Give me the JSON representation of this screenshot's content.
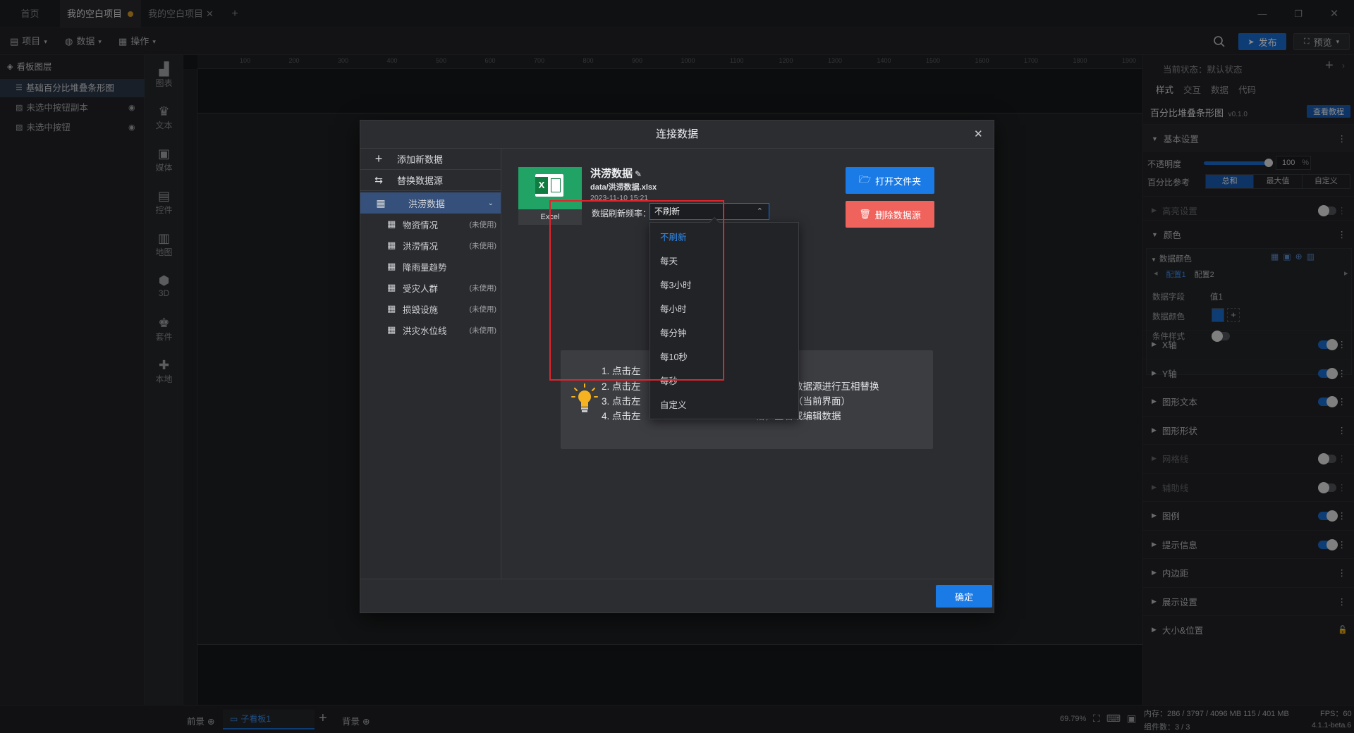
{
  "tabs": [
    {
      "label": "首页"
    },
    {
      "label": "我的空白项目"
    },
    {
      "label": "我的空白项目"
    }
  ],
  "toolbar": {
    "project": "项目",
    "data": "数据",
    "operate": "操作",
    "publish": "发布",
    "preview": "预览"
  },
  "layers": {
    "title": "看板图层",
    "items": [
      {
        "label": "基础百分比堆叠条形图"
      },
      {
        "label": "未选中按钮副本"
      },
      {
        "label": "未选中按钮"
      }
    ]
  },
  "rail": [
    {
      "label": "图表",
      "icon": "chart-icon"
    },
    {
      "label": "文本",
      "icon": "text-icon"
    },
    {
      "label": "媒体",
      "icon": "media-icon"
    },
    {
      "label": "控件",
      "icon": "control-icon"
    },
    {
      "label": "地图",
      "icon": "map-icon"
    },
    {
      "label": "3D",
      "icon": "cube-icon"
    },
    {
      "label": "套件",
      "icon": "kit-icon"
    },
    {
      "label": "本地",
      "icon": "puzzle-icon"
    }
  ],
  "ruler": {
    "ticks": [
      "100",
      "200",
      "300",
      "400",
      "500",
      "600",
      "700",
      "800",
      "900",
      "1000",
      "1100",
      "1200",
      "1300",
      "1400",
      "1500",
      "1600",
      "1700",
      "1800",
      "1900"
    ]
  },
  "props": {
    "state_label": "当前状态：",
    "state_value": "默认状态",
    "tabs": [
      "样式",
      "交互",
      "数据",
      "代码"
    ],
    "component_name": "百分比堆叠条形图",
    "version": "v0.1.0",
    "tutorial_btn": "查看教程",
    "basic_settings": "基本设置",
    "opacity_label": "不透明度",
    "opacity_value": "100",
    "opacity_unit": "%",
    "percent_ref_label": "百分比参考",
    "percent_ref_options": [
      "总和",
      "最大值",
      "自定义"
    ],
    "highlight": "高亮设置",
    "color": "颜色",
    "data_color": "数据颜色",
    "config_tabs": [
      "配置1",
      "配置2"
    ],
    "data_field_label": "数据字段",
    "data_field_value": "值1",
    "data_color_label": "数据颜色",
    "condition_style_label": "条件样式",
    "sections": [
      {
        "label": "X轴",
        "toggle": "on",
        "dim": false
      },
      {
        "label": "Y轴",
        "toggle": "on",
        "dim": false
      },
      {
        "label": "图形文本",
        "toggle": "on",
        "dim": false
      },
      {
        "label": "图形形状",
        "toggle": "none",
        "dim": false
      },
      {
        "label": "网格线",
        "toggle": "off",
        "dim": true
      },
      {
        "label": "辅助线",
        "toggle": "off",
        "dim": true
      },
      {
        "label": "图例",
        "toggle": "on",
        "dim": false
      },
      {
        "label": "提示信息",
        "toggle": "on",
        "dim": false
      },
      {
        "label": "内边距",
        "toggle": "none",
        "dim": false
      },
      {
        "label": "展示设置",
        "toggle": "none",
        "dim": false
      },
      {
        "label": "大小&位置",
        "toggle": "none",
        "dim": false
      }
    ]
  },
  "status": {
    "front": "前景",
    "board": "子看板1",
    "background": "背景",
    "zoom": "69.79%",
    "memory": "内存：286 / 3797 / 4096 MB  115 / 401 MB",
    "fps": "FPS：60",
    "components": "组件数：3 / 3",
    "version": "4.1.1-beta.6"
  },
  "dialog": {
    "title": "连接数据",
    "add_new": "添加新数据",
    "replace": "替换数据源",
    "current_source": "洪涝数据",
    "sheets": [
      {
        "name": "物资情况",
        "unused": "(未使用)"
      },
      {
        "name": "洪涝情况",
        "unused": "(未使用)"
      },
      {
        "name": "降雨量趋势",
        "unused": ""
      },
      {
        "name": "受灾人群",
        "unused": "(未使用)"
      },
      {
        "name": "损毁设施",
        "unused": "(未使用)"
      },
      {
        "name": "洪灾水位线",
        "unused": "(未使用)"
      }
    ],
    "excel_label": "Excel",
    "source_name": "洪涝数据",
    "source_path": "data/洪涝数据.xlsx",
    "source_date": "2023-11-10 15:21",
    "refresh_label": "数据刷新频率：",
    "refresh_value": "不刷新",
    "open_folder": "打开文件夹",
    "delete_source": "删除数据源",
    "refresh_options": [
      "不刷新",
      "每天",
      "每3小时",
      "每小时",
      "每分钟",
      "每10秒",
      "每秒",
      "自定义"
    ],
    "tips_left": [
      "1. 点击左",
      "2. 点击左",
      "3. 点击左",
      "4. 点击左"
    ],
    "tips_right": [
      "据源",
      "已添加的数据源进行互相替换",
      "据源属性（当前界面）",
      "格，查看或编辑数据"
    ],
    "confirm": "确定"
  },
  "colors": {
    "accent": "#1a7ae6",
    "danger": "#f0625c",
    "excel": "#21a366",
    "highlight_box": "#e0242c"
  }
}
